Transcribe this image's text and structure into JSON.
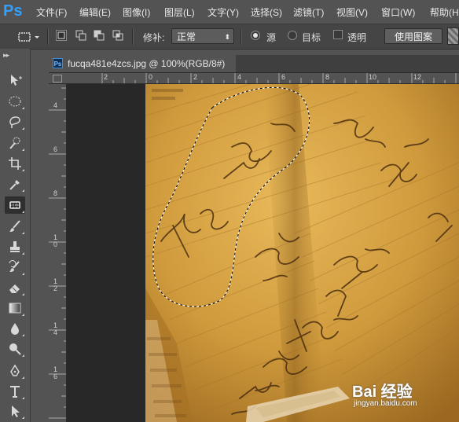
{
  "app": {
    "logo": "Ps"
  },
  "menubar": {
    "items": [
      "文件(F)",
      "编辑(E)",
      "图像(I)",
      "图层(L)",
      "文字(Y)",
      "选择(S)",
      "滤镜(T)",
      "视图(V)",
      "窗口(W)",
      "帮助(H)"
    ]
  },
  "options": {
    "patch_label": "修补:",
    "patch_mode": "正常",
    "source_label": "源",
    "target_label": "目标",
    "transparent_label": "透明",
    "use_pattern_label": "使用图案",
    "source_selected": true,
    "target_selected": false,
    "transparent_checked": false
  },
  "toolbar": {
    "tools": [
      {
        "name": "move-tool",
        "icon": "move-icon"
      },
      {
        "name": "marquee-tool",
        "icon": "elliptical-marquee-icon"
      },
      {
        "name": "lasso-tool",
        "icon": "lasso-icon"
      },
      {
        "name": "quick-selection-tool",
        "icon": "quick-selection-icon"
      },
      {
        "name": "crop-tool",
        "icon": "crop-icon"
      },
      {
        "name": "eyedropper-tool",
        "icon": "eyedropper-icon"
      },
      {
        "name": "patch-tool",
        "icon": "patch-icon",
        "active": true
      },
      {
        "name": "brush-tool",
        "icon": "brush-icon"
      },
      {
        "name": "clone-stamp-tool",
        "icon": "stamp-icon"
      },
      {
        "name": "history-brush-tool",
        "icon": "history-brush-icon"
      },
      {
        "name": "eraser-tool",
        "icon": "eraser-icon"
      },
      {
        "name": "gradient-tool",
        "icon": "gradient-icon"
      },
      {
        "name": "blur-tool",
        "icon": "drop-icon"
      },
      {
        "name": "dodge-tool",
        "icon": "dodge-icon"
      },
      {
        "name": "pen-tool",
        "icon": "pen-icon"
      },
      {
        "name": "type-tool",
        "icon": "type-icon"
      },
      {
        "name": "path-selection-tool",
        "icon": "arrow-icon"
      }
    ]
  },
  "document": {
    "tab_title": "fucqa481e4zcs.jpg @ 100%(RGB/8#)",
    "ps_badge": "Ps"
  },
  "rulers": {
    "top_labels": [
      "2",
      "0",
      "2",
      "4",
      "6",
      "8",
      "10",
      "12"
    ],
    "left_labels": [
      "4",
      "6",
      "8",
      "1 0",
      "1 2",
      "1 4",
      "1 6"
    ]
  },
  "watermark": {
    "brand": "Bai 经验",
    "url": "jingyan.baidu.com"
  },
  "colors": {
    "photo_tone": "#c9922f",
    "accent": "#32a0ff"
  }
}
